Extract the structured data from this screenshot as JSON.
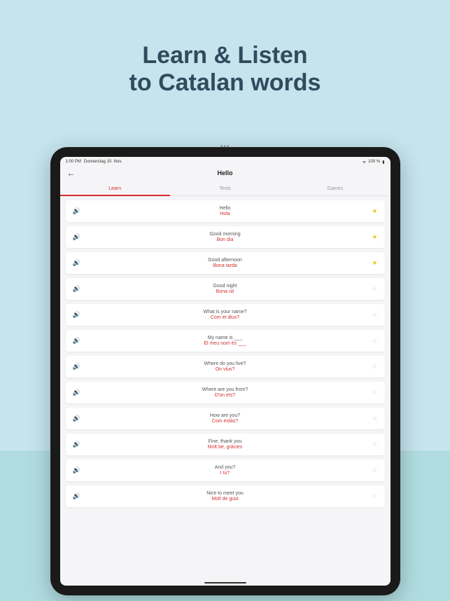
{
  "promo": {
    "line1": "Learn & Listen",
    "line2": "to Catalan words"
  },
  "status": {
    "time": "1:00 PM",
    "date": "Donnerstag 10. Nov.",
    "battery": "100 %"
  },
  "nav": {
    "title": "Hello",
    "back": "←",
    "dots": "•••"
  },
  "tabs": [
    {
      "label": "Learn",
      "active": true
    },
    {
      "label": "Tests",
      "active": false
    },
    {
      "label": "Games",
      "active": false
    }
  ],
  "icons": {
    "speaker": "🔊",
    "star_filled": "★",
    "star_empty": "☆",
    "wifi": "ᯤ",
    "battery": "▮"
  },
  "words": [
    {
      "en": "Hello",
      "ca": "Hola",
      "fav": true
    },
    {
      "en": "Good morning",
      "ca": "Bon dia",
      "fav": true
    },
    {
      "en": "Good afternoon",
      "ca": "Bona tarda",
      "fav": true
    },
    {
      "en": "Good night",
      "ca": "Bona nit",
      "fav": false
    },
    {
      "en": "What is your name?",
      "ca": "Com et dius?",
      "fav": false
    },
    {
      "en": "My name is ___",
      "ca": "El meu nom és ___",
      "fav": false
    },
    {
      "en": "Where do you live?",
      "ca": "On vius?",
      "fav": false
    },
    {
      "en": "Where are you from?",
      "ca": "D'on ets?",
      "fav": false
    },
    {
      "en": "How are you?",
      "ca": "Com estàs?",
      "fav": false
    },
    {
      "en": "Fine, thank you",
      "ca": "Molt bé, gràcies",
      "fav": false
    },
    {
      "en": "And you?",
      "ca": "I tu?",
      "fav": false
    },
    {
      "en": "Nice to meet you",
      "ca": "Molt de gust",
      "fav": false
    }
  ]
}
